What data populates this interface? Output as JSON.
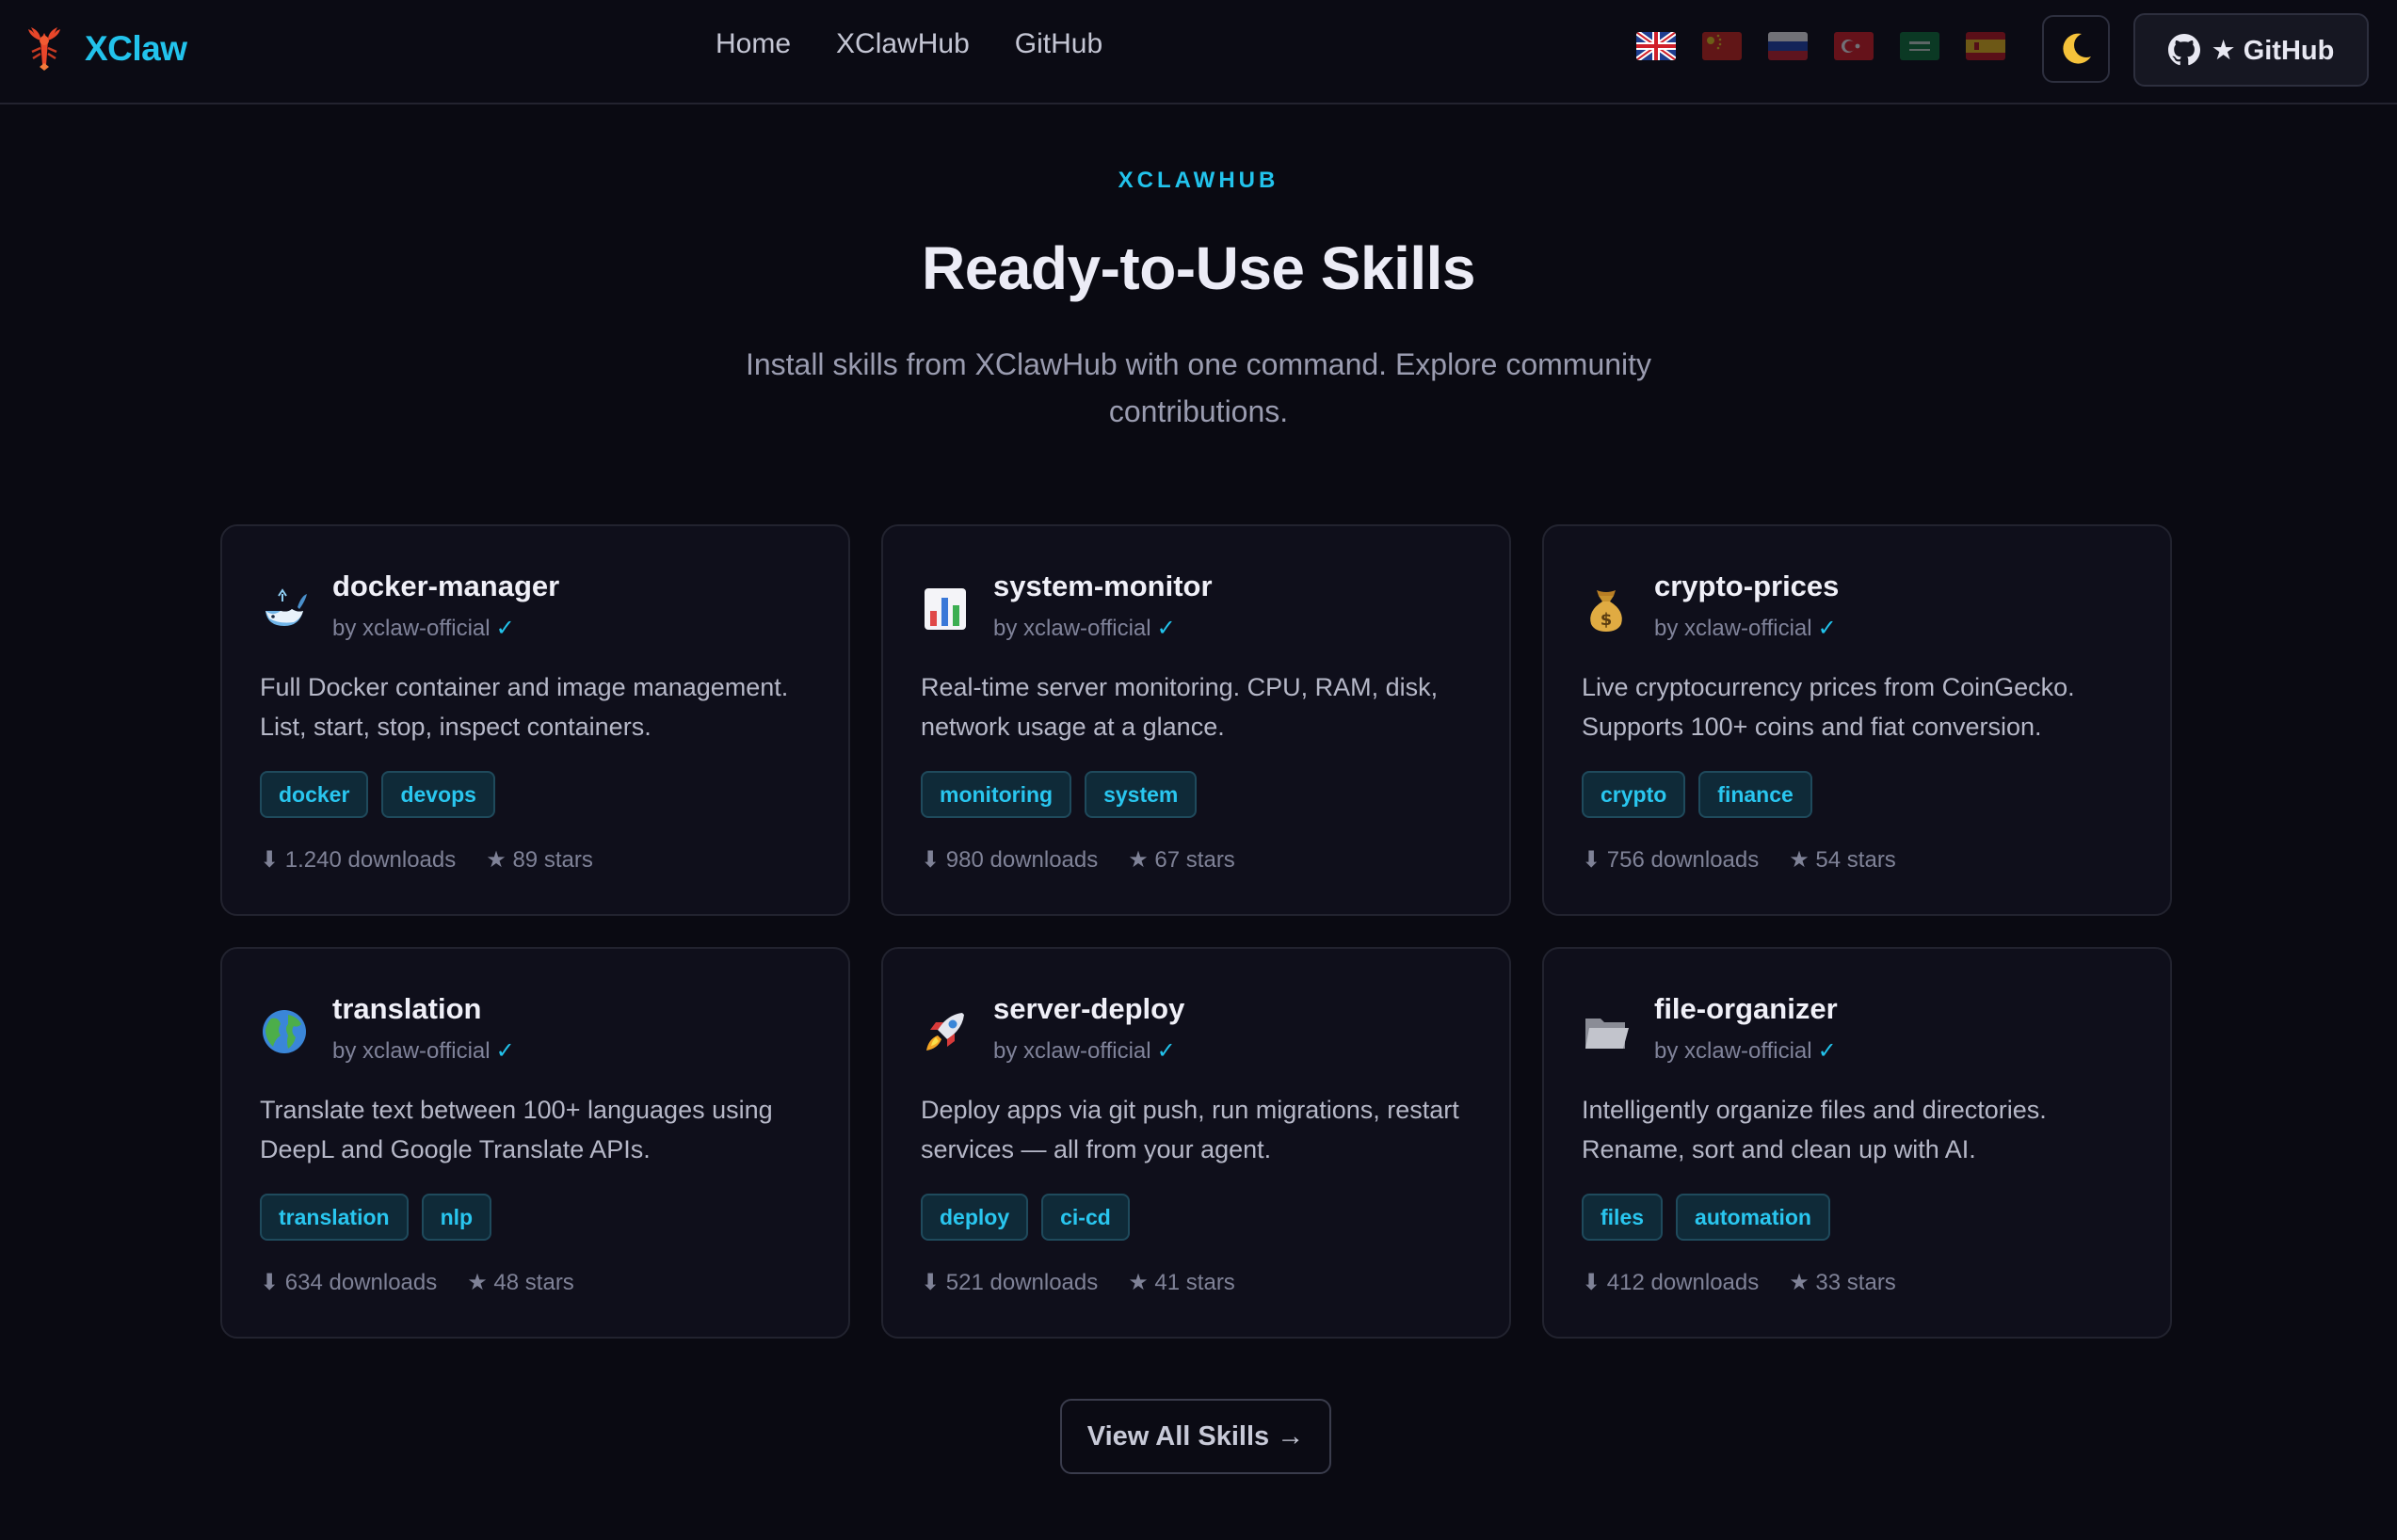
{
  "nav": {
    "brand": "XClaw",
    "links": [
      "Home",
      "XClawHub",
      "GitHub"
    ],
    "github_button": "★ GitHub"
  },
  "section": {
    "eyebrow": "XCLAWHUB",
    "title": "Ready-to-Use Skills",
    "subtitle": "Install skills from XClawHub with one command. Explore community contributions."
  },
  "skills": [
    {
      "icon": "whale-icon",
      "name": "docker-manager",
      "author": "by xclaw-official",
      "verified": "✓",
      "description": "Full Docker container and image management. List, start, stop, inspect containers.",
      "tags": [
        "docker",
        "devops"
      ],
      "downloads": "⬇ 1.240 downloads",
      "stars": "★ 89 stars"
    },
    {
      "icon": "bar-chart-icon",
      "name": "system-monitor",
      "author": "by xclaw-official",
      "verified": "✓",
      "description": "Real-time server monitoring. CPU, RAM, disk, network usage at a glance.",
      "tags": [
        "monitoring",
        "system"
      ],
      "downloads": "⬇ 980 downloads",
      "stars": "★ 67 stars"
    },
    {
      "icon": "money-bag-icon",
      "name": "crypto-prices",
      "author": "by xclaw-official",
      "verified": "✓",
      "description": "Live cryptocurrency prices from CoinGecko. Supports 100+ coins and fiat conversion.",
      "tags": [
        "crypto",
        "finance"
      ],
      "downloads": "⬇ 756 downloads",
      "stars": "★ 54 stars"
    },
    {
      "icon": "globe-icon",
      "name": "translation",
      "author": "by xclaw-official",
      "verified": "✓",
      "description": "Translate text between 100+ languages using DeepL and Google Translate APIs.",
      "tags": [
        "translation",
        "nlp"
      ],
      "downloads": "⬇ 634 downloads",
      "stars": "★ 48 stars"
    },
    {
      "icon": "rocket-icon",
      "name": "server-deploy",
      "author": "by xclaw-official",
      "verified": "✓",
      "description": "Deploy apps via git push, run migrations, restart services — all from your agent.",
      "tags": [
        "deploy",
        "ci-cd"
      ],
      "downloads": "⬇ 521 downloads",
      "stars": "★ 41 stars"
    },
    {
      "icon": "folder-icon",
      "name": "file-organizer",
      "author": "by xclaw-official",
      "verified": "✓",
      "description": "Intelligently organize files and directories. Rename, sort and clean up with AI.",
      "tags": [
        "files",
        "automation"
      ],
      "downloads": "⬇ 412 downloads",
      "stars": "★ 33 stars"
    }
  ],
  "cta": "View All Skills →",
  "colors": {
    "accent": "#22c3ec",
    "background": "#0a0a12",
    "card": "#0f0f1b",
    "tag_bg": "#0f2a38"
  }
}
